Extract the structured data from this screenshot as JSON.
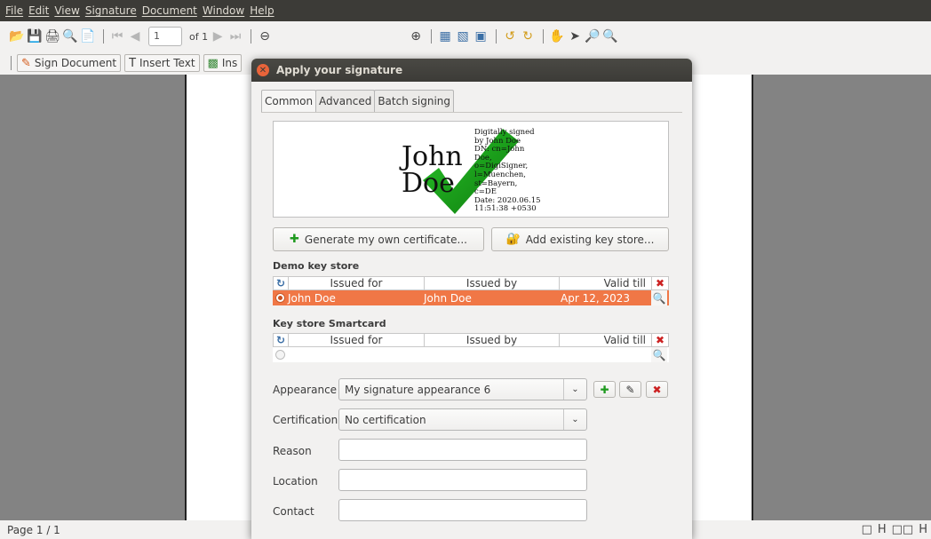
{
  "menubar": {
    "items": [
      "File",
      "Edit",
      "View",
      "Signature",
      "Document",
      "Window",
      "Help"
    ]
  },
  "toolbar": {
    "page_value": "1",
    "page_of": "of 1"
  },
  "toolbar2": {
    "sign_document": "Sign Document",
    "insert_text": "Insert Text",
    "insert_image": "Ins"
  },
  "status": {
    "page": "Page 1 / 1"
  },
  "dialog": {
    "title": "Apply your signature",
    "tabs": [
      "Common",
      "Advanced",
      "Batch signing"
    ],
    "signature": {
      "name_line1": "John",
      "name_line2": "Doe",
      "details": "Digitally signed\nby John Doe\nDN: cn=John\nDoe,\no=DigiSigner,\nl=Muenchen,\nst=Bayern,\nc=DE\nDate: 2020.06.15\n11:51:38 +0530"
    },
    "generate_button": "Generate my own certificate...",
    "add_keystore_button": "Add existing key store...",
    "demo_keystore": {
      "label": "Demo key store",
      "columns": [
        "Issued for",
        "Issued by",
        "Valid till"
      ],
      "rows": [
        {
          "issued_for": "John Doe",
          "issued_by": "John Doe",
          "valid_till": "Apr 12, 2023"
        }
      ]
    },
    "smartcard_keystore": {
      "label": "Key store Smartcard",
      "columns": [
        "Issued for",
        "Issued by",
        "Valid till"
      ]
    },
    "appearance": {
      "label": "Appearance",
      "value": "My signature appearance 6"
    },
    "certification": {
      "label": "Certification",
      "value": "No certification"
    },
    "reason": {
      "label": "Reason",
      "value": ""
    },
    "location": {
      "label": "Location",
      "value": ""
    },
    "contact": {
      "label": "Contact",
      "value": ""
    }
  },
  "colors": {
    "selected_row": "#f07746",
    "menubar_bg": "#3c3b37",
    "document_bg": "#838383",
    "check_green": "#1fa51f"
  }
}
